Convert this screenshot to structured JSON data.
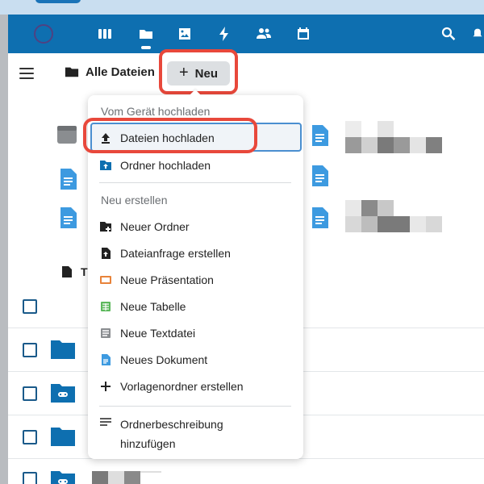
{
  "breadcrumb": {
    "label": "Alle Dateien"
  },
  "new_button": {
    "label": "Neu"
  },
  "partial_column_label": "T",
  "menu": {
    "upload_heading": "Vom Gerät hochladen",
    "upload_items": [
      {
        "label": "Dateien hochladen",
        "icon": "upload-icon"
      },
      {
        "label": "Ordner hochladen",
        "icon": "folder-upload-icon"
      }
    ],
    "create_heading": "Neu erstellen",
    "create_items": [
      {
        "label": "Neuer Ordner",
        "icon": "folder-plus-icon"
      },
      {
        "label": "Dateianfrage erstellen",
        "icon": "file-request-icon"
      },
      {
        "label": "Neue Präsentation",
        "icon": "presentation-icon"
      },
      {
        "label": "Neue Tabelle",
        "icon": "spreadsheet-icon"
      },
      {
        "label": "Neue Textdatei",
        "icon": "text-file-icon"
      },
      {
        "label": "Neues Dokument",
        "icon": "document-icon"
      },
      {
        "label": "Vorlagenordner erstellen",
        "icon": "plus-icon"
      }
    ],
    "description_item": {
      "label_line1": "Ordnerbeschreibung",
      "label_line2": "hinzufügen",
      "icon": "lines-icon"
    }
  },
  "colors": {
    "header": "#0e6fb0",
    "highlight": "#e8483b",
    "folder": "#0e6fb0",
    "doc": "#3d9ae0"
  }
}
